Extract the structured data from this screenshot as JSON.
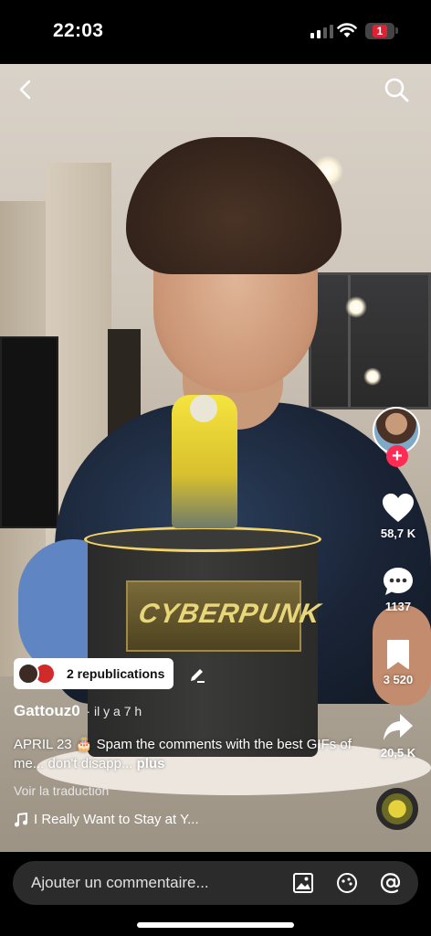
{
  "status_bar": {
    "time": "22:03",
    "battery_level": "1",
    "signal_bars_active": 2
  },
  "video": {
    "cake_text": "CYBERPUNK"
  },
  "top_bar": {
    "back_icon": "chevron-left-icon",
    "search_icon": "search-icon"
  },
  "rail": {
    "likes": "58,7 K",
    "comments": "1137",
    "saves": "3 520",
    "shares": "20,5 K",
    "follow_symbol": "+",
    "colors": {
      "follow": "#fe2c55"
    }
  },
  "post": {
    "republications": "2 republications",
    "username": "Gattouz0",
    "time_ago": "· il y a 7 h",
    "caption": "APRIL 23 🎂 Spam the comments with the best GIFs of me... don't disapp...",
    "more_label": "plus",
    "translate_label": "Voir la traduction",
    "music": "I Really Want to Stay at Y..."
  },
  "comment": {
    "placeholder": "Ajouter un commentaire..."
  }
}
